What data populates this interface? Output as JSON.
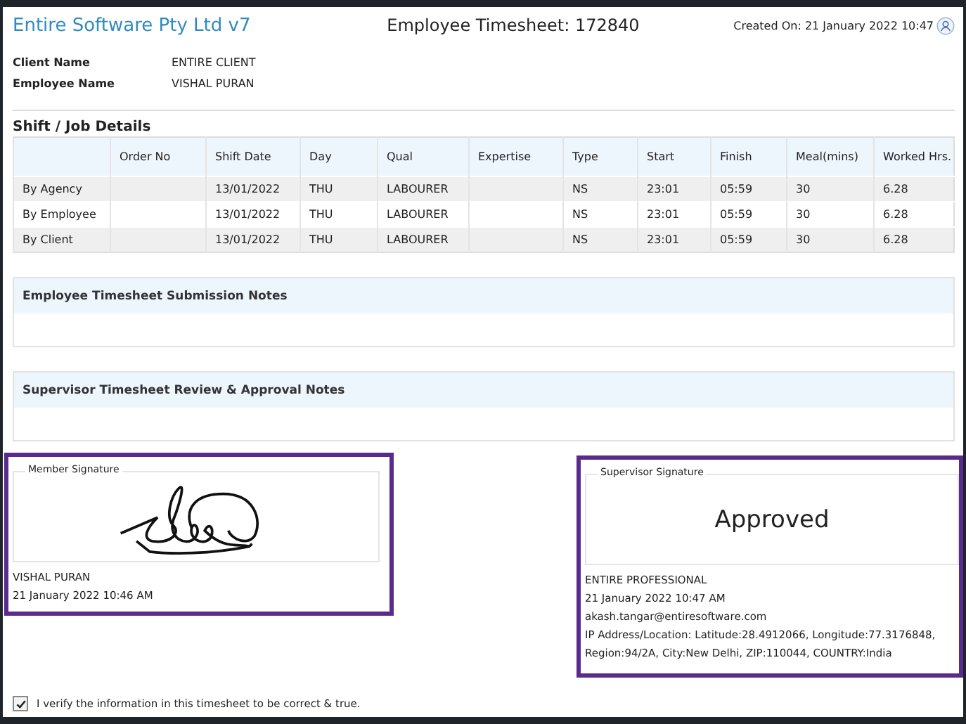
{
  "header": {
    "company": "Entire Software Pty Ltd v7",
    "title": "Employee Timesheet: 172840",
    "created": "Created On: 21 January 2022 10:47"
  },
  "details": [
    {
      "label": "Client Name",
      "value": "ENTIRE CLIENT"
    },
    {
      "label": "Employee Name",
      "value": "VISHAL PURAN"
    }
  ],
  "shift_section": {
    "title": "Shift / Job Details",
    "columns": [
      "",
      "Order No",
      "Shift Date",
      "Day",
      "Qual",
      "Expertise",
      "Type",
      "Start",
      "Finish",
      "Meal(mins)",
      "Worked Hrs."
    ],
    "rows": [
      [
        "By Agency",
        "",
        "13/01/2022",
        "THU",
        "LABOURER",
        "",
        "NS",
        "23:01",
        "05:59",
        "30",
        "6.28"
      ],
      [
        "By Employee",
        "",
        "13/01/2022",
        "THU",
        "LABOURER",
        "",
        "NS",
        "23:01",
        "05:59",
        "30",
        "6.28"
      ],
      [
        "By Client",
        "",
        "13/01/2022",
        "THU",
        "LABOURER",
        "",
        "NS",
        "23:01",
        "05:59",
        "30",
        "6.28"
      ]
    ]
  },
  "notes": [
    {
      "title": "Employee Timesheet Submission Notes"
    },
    {
      "title": "Supervisor Timesheet Review & Approval Notes"
    }
  ],
  "member_signature": {
    "legend": "Member Signature",
    "name": "VISHAL PURAN",
    "date": "21 January 2022 10:46 AM"
  },
  "supervisor_signature": {
    "legend": "Supervisor Signature",
    "status": "Approved",
    "name": "ENTIRE PROFESSIONAL",
    "date": "21 January 2022 10:47 AM",
    "email": "akash.tangar@entiresoftware.com",
    "location": "IP Address/Location: Latitude:28.4912066, Longitude:77.3176848, Region:94/2A, City:New Delhi, ZIP:110044, COUNTRY:India"
  },
  "verify": {
    "label": "I verify the information in this timesheet to be correct & true.",
    "checked": true
  }
}
